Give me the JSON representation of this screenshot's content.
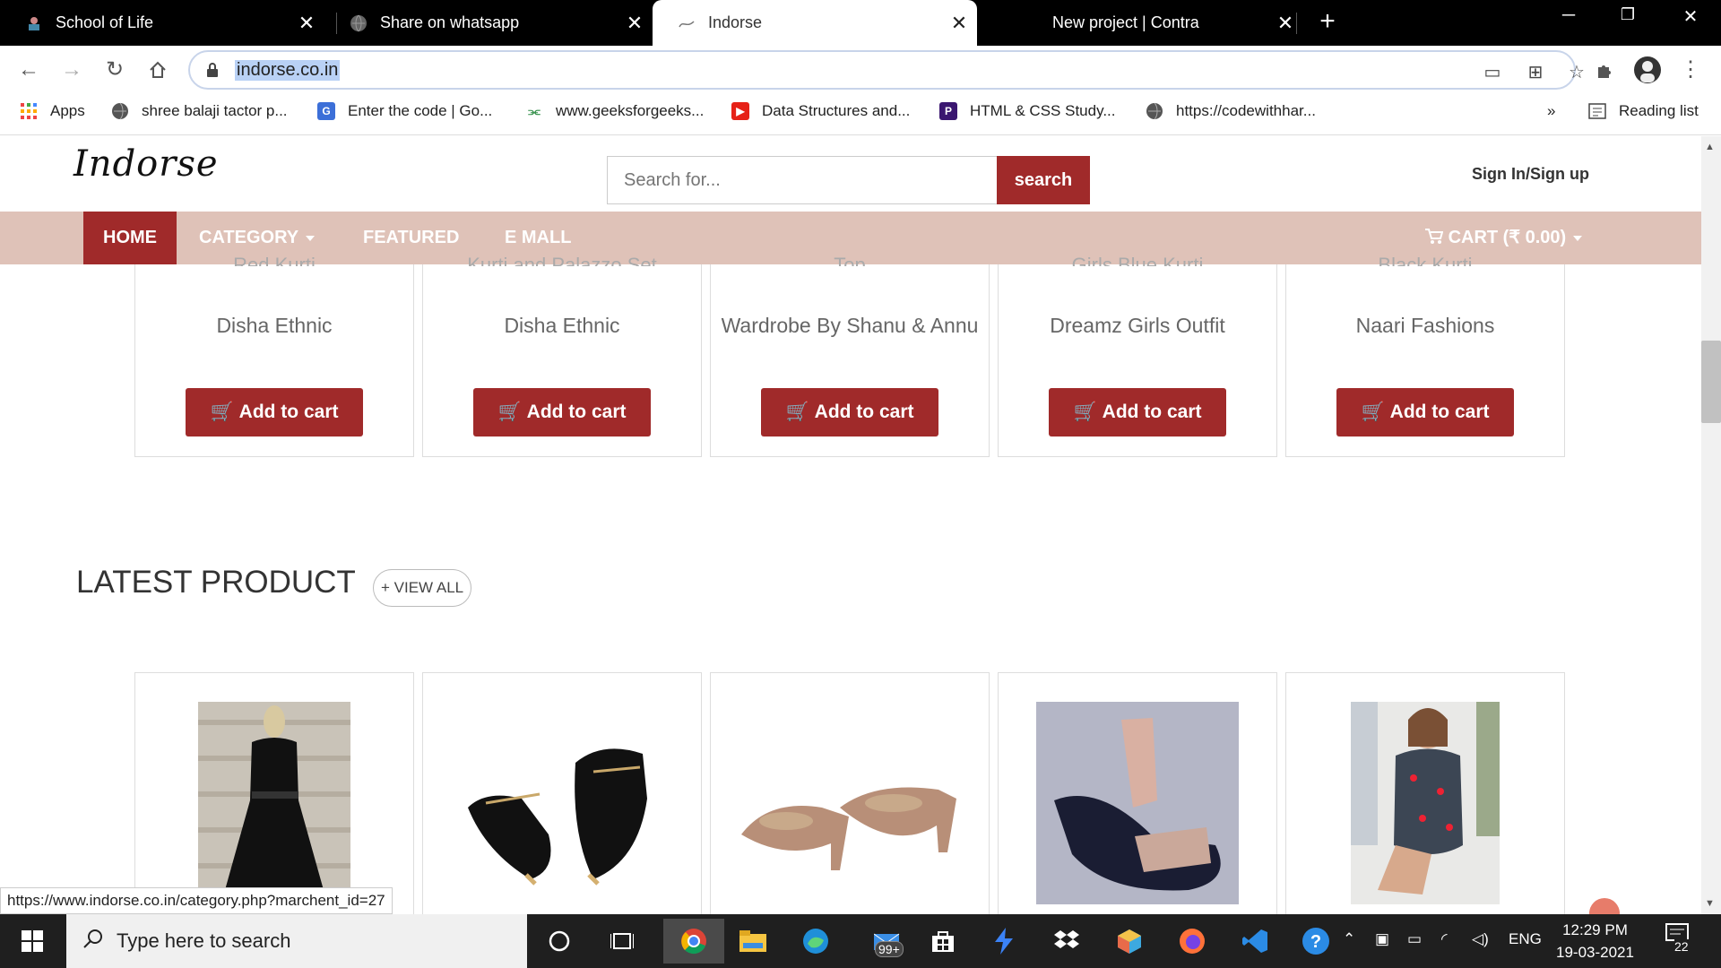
{
  "browser": {
    "tabs": [
      {
        "title": "School of Life",
        "active": false
      },
      {
        "title": "Share on whatsapp",
        "active": false
      },
      {
        "title": "Indorse",
        "active": true
      },
      {
        "title": "New project | Contra",
        "active": false
      }
    ],
    "url": "indorse.co.in",
    "bookmarks": [
      {
        "label": "Apps",
        "icon": "apps-grid-icon"
      },
      {
        "label": "shree balaji tactor p...",
        "icon": "globe-icon"
      },
      {
        "label": "Enter the code | Go...",
        "icon": "google-icon"
      },
      {
        "label": "www.geeksforgeeks...",
        "icon": "gfg-icon"
      },
      {
        "label": "Data Structures and...",
        "icon": "youtube-icon"
      },
      {
        "label": "HTML & CSS Study...",
        "icon": "p-icon"
      },
      {
        "label": "https://codewithhar...",
        "icon": "globe-icon"
      }
    ],
    "more_bookmarks": "»",
    "reading_list": "Reading list",
    "status_url": "https://www.indorse.co.in/category.php?marchent_id=27"
  },
  "site": {
    "logo_text": "Indorse",
    "search_placeholder": "Search for...",
    "search_button": "search",
    "signin": "Sign In/Sign up",
    "nav": {
      "home": "HOME",
      "category": "CATEGORY",
      "featured": "FEATURED",
      "emall": "E MALL",
      "cart": "CART (₹ 0.00)"
    },
    "top_products": [
      {
        "title_fragment": "Red Kurti",
        "vendor": "Disha Ethnic"
      },
      {
        "title_fragment": "Kurti and Palazzo Set",
        "vendor": "Disha Ethnic"
      },
      {
        "title_fragment": "Top",
        "vendor": "Wardrobe By Shanu & Annu"
      },
      {
        "title_fragment": "Girls Blue Kurti",
        "vendor": "Dreamz Girls Outfit"
      },
      {
        "title_fragment": "Black Kurti",
        "vendor": "Naari Fashions"
      }
    ],
    "add_to_cart": "Add to cart",
    "latest_title": "LATEST PRODUCT",
    "view_all": "+ VIEW ALL"
  },
  "taskbar": {
    "search_placeholder": "Type here to search",
    "mail_badge": "99+",
    "language": "ENG",
    "time": "12:29 PM",
    "date": "19-03-2021",
    "notification_count": "22"
  },
  "colors": {
    "brand_red": "#a02a2a",
    "nav_bg": "#dfc2b8"
  }
}
